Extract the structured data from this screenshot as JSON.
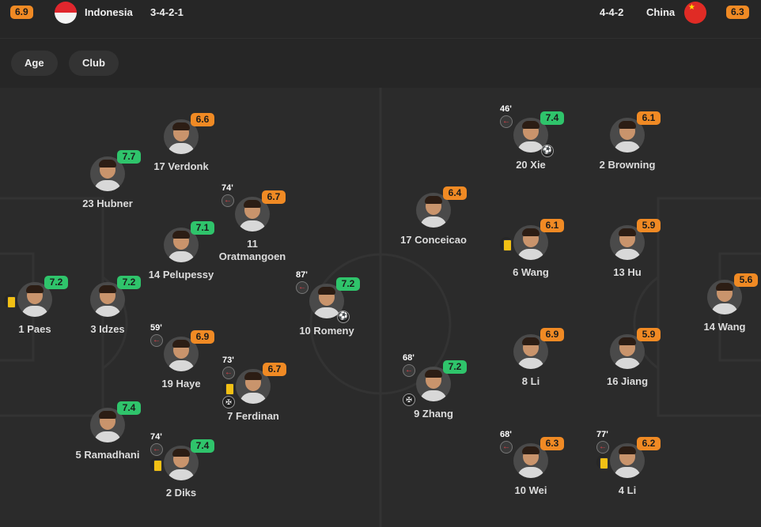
{
  "home": {
    "rating": "6.9",
    "name": "Indonesia",
    "formation": "3-4-2-1",
    "flag": "indonesia-flag"
  },
  "away": {
    "rating": "6.3",
    "name": "China",
    "formation": "4-4-2",
    "flag": "china-flag"
  },
  "filters": {
    "age": "Age",
    "club": "Club"
  },
  "colors": {
    "good": "#2fc46b",
    "average": "#f08a24",
    "card": "#f2c014"
  },
  "players": [
    {
      "id": "verdonk",
      "name": "17 Verdonk",
      "rating": "6.6",
      "tier": "orange"
    },
    {
      "id": "hubner",
      "name": "23 Hubner",
      "rating": "7.7",
      "tier": "green"
    },
    {
      "id": "oratmangoen",
      "name": "11\nOratmangoen",
      "rating": "6.7",
      "tier": "orange",
      "sub": "74'"
    },
    {
      "id": "pelupessy",
      "name": "14 Pelupessy",
      "rating": "7.1",
      "tier": "green"
    },
    {
      "id": "paes",
      "name": "1 Paes",
      "rating": "7.2",
      "tier": "green",
      "card": "yellow"
    },
    {
      "id": "idzes",
      "name": "3 Idzes",
      "rating": "7.2",
      "tier": "green"
    },
    {
      "id": "romeny",
      "name": "10 Romeny",
      "rating": "7.2",
      "tier": "green",
      "sub": "87'",
      "goal": true
    },
    {
      "id": "haye",
      "name": "19 Haye",
      "rating": "6.9",
      "tier": "orange",
      "sub": "59'"
    },
    {
      "id": "ferdinan",
      "name": "7 Ferdinan",
      "rating": "6.7",
      "tier": "orange",
      "sub": "73'",
      "card": "yellow",
      "assist": true
    },
    {
      "id": "ramadhani",
      "name": "5 Ramadhani",
      "rating": "7.4",
      "tier": "green"
    },
    {
      "id": "diks",
      "name": "2 Diks",
      "rating": "7.4",
      "tier": "green",
      "sub": "74'",
      "card": "yellow"
    },
    {
      "id": "xie",
      "name": "20 Xie",
      "rating": "7.4",
      "tier": "green",
      "sub": "46'",
      "goal": true
    },
    {
      "id": "browning",
      "name": "2 Browning",
      "rating": "6.1",
      "tier": "orange"
    },
    {
      "id": "conceicao",
      "name": "17 Conceicao",
      "rating": "6.4",
      "tier": "orange"
    },
    {
      "id": "wang6",
      "name": "6 Wang",
      "rating": "6.1",
      "tier": "orange",
      "card": "yellow"
    },
    {
      "id": "hu",
      "name": "13 Hu",
      "rating": "5.9",
      "tier": "orange"
    },
    {
      "id": "wang14",
      "name": "14 Wang",
      "rating": "5.6",
      "tier": "orange"
    },
    {
      "id": "zhang",
      "name": "9 Zhang",
      "rating": "7.2",
      "tier": "green",
      "sub": "68'",
      "assist": true
    },
    {
      "id": "li8",
      "name": "8 Li",
      "rating": "6.9",
      "tier": "orange"
    },
    {
      "id": "jiang",
      "name": "16 Jiang",
      "rating": "5.9",
      "tier": "orange"
    },
    {
      "id": "wei",
      "name": "10 Wei",
      "rating": "6.3",
      "tier": "orange",
      "sub": "68'"
    },
    {
      "id": "li4",
      "name": "4 Li",
      "rating": "6.2",
      "tier": "orange",
      "sub": "77'",
      "card": "yellow"
    }
  ]
}
